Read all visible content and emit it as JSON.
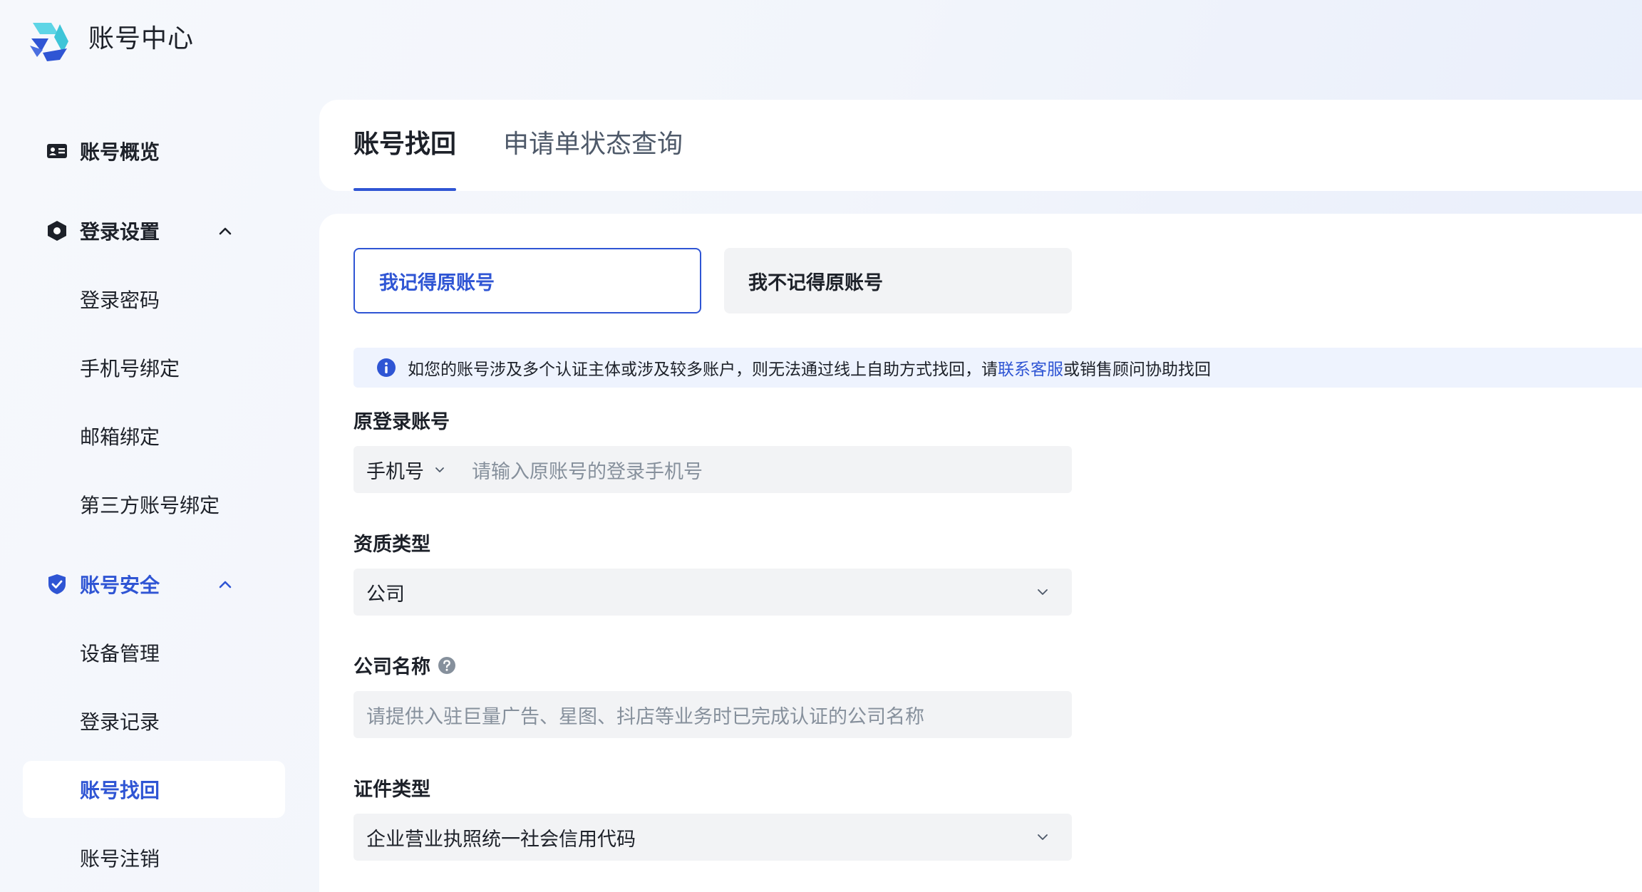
{
  "header": {
    "brand": "账号中心"
  },
  "sidebar": {
    "overview": "账号概览",
    "login_settings": {
      "label": "登录设置",
      "items": [
        "登录密码",
        "手机号绑定",
        "邮箱绑定",
        "第三方账号绑定"
      ]
    },
    "account_security": {
      "label": "账号安全",
      "items": [
        "设备管理",
        "登录记录",
        "账号找回",
        "账号注销"
      ]
    }
  },
  "tabs": [
    "账号找回",
    "申请单状态查询"
  ],
  "options": {
    "remember": "我记得原账号",
    "forget": "我不记得原账号"
  },
  "notice": {
    "text_before": "如您的账号涉及多个认证主体或涉及较多账户，则无法通过线上自助方式找回，请",
    "link": "联系客服",
    "text_after": "或销售顾问协助找回"
  },
  "form": {
    "original_account": {
      "label": "原登录账号",
      "prefix": "手机号",
      "placeholder": "请输入原账号的登录手机号"
    },
    "qualification_type": {
      "label": "资质类型",
      "value": "公司"
    },
    "company_name": {
      "label": "公司名称",
      "placeholder": "请提供入驻巨量广告、星图、抖店等业务时已完成认证的公司名称"
    },
    "certificate_type": {
      "label": "证件类型",
      "value": "企业营业执照统一社会信用代码"
    }
  },
  "colors": {
    "accent": "#2f55d4",
    "field_bg": "#f2f3f5",
    "notice_bg": "#eef3fe"
  }
}
